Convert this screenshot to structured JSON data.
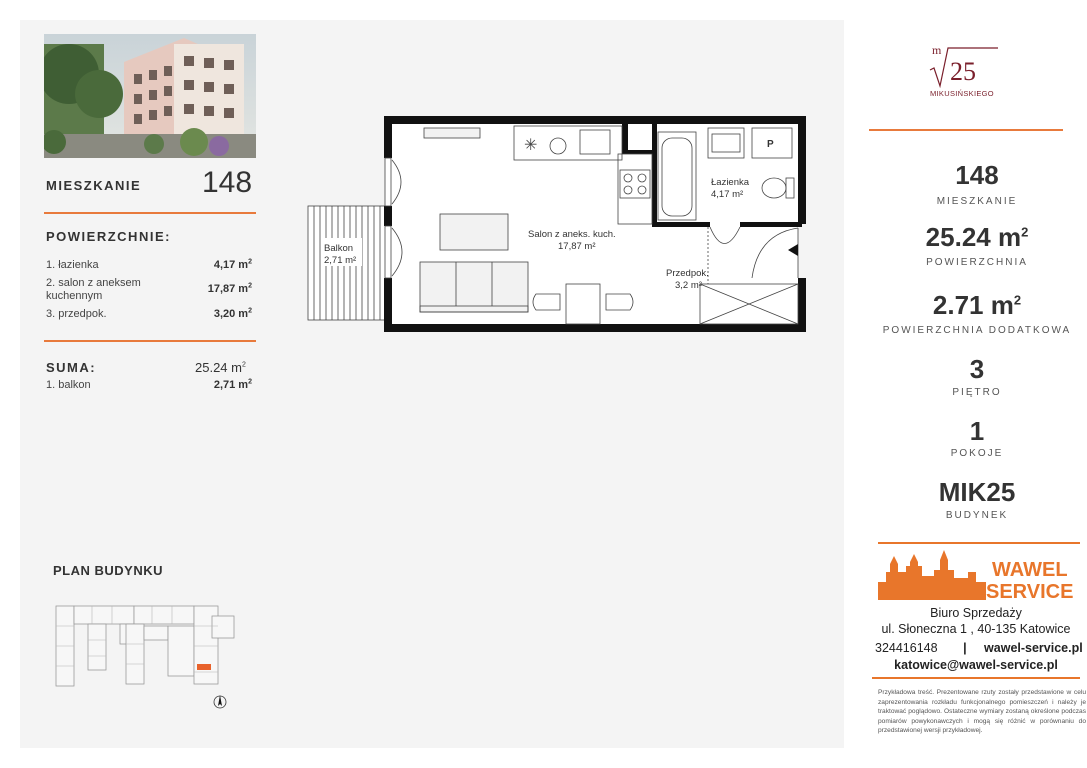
{
  "apartment": {
    "label": "MIESZKANIE",
    "number": "148"
  },
  "rooms_section": {
    "title": "POWIERZCHNIE:",
    "rooms": [
      {
        "name": "1. łazienka",
        "value": "4,17 m"
      },
      {
        "name": "2. salon z aneksem kuchennym",
        "value": "17,87 m"
      },
      {
        "name": "3. przedpok.",
        "value": "3,20 m"
      }
    ]
  },
  "summary": {
    "label": "SUMA:",
    "value": "25.24  m",
    "balcony_name": "1. balkon",
    "balcony_value": "2,71 m"
  },
  "floorplan": {
    "balcony": {
      "name": "Balkon",
      "area": "2,71 m²"
    },
    "living": {
      "name": "Salon z aneks. kuch.",
      "area": "17,87 m²"
    },
    "bathroom": {
      "name": "Łazienka",
      "area": "4,17 m²"
    },
    "hall": {
      "name": "Przedpok.",
      "area": "3,2 m²"
    },
    "wardrobe_letter": "P"
  },
  "building_plan": {
    "title": "PLAN BUDYNKU"
  },
  "logo": {
    "superscript": "m",
    "number": "25",
    "caption": "MIKUSIŃSKIEGO"
  },
  "stats": [
    {
      "value": "148",
      "unit": "",
      "label": "MIESZKANIE"
    },
    {
      "value": "25.24 m",
      "unit": "2",
      "label": "POWIERZCHNIA"
    },
    {
      "value": "2.71 m",
      "unit": "2",
      "label": "POWIERZCHNIA DODATKOWA"
    },
    {
      "value": "3",
      "unit": "",
      "label": "PIĘTRO"
    },
    {
      "value": "1",
      "unit": "",
      "label": "POKOJE"
    },
    {
      "value": "MIK25",
      "unit": "",
      "label": "BUDYNEK"
    }
  ],
  "agency": {
    "name_line1": "WAWEL",
    "name_line2": "SERVICE",
    "office_title": "Biuro Sprzedaży",
    "address": "ul. Słoneczna 1 , 40-135 Katowice",
    "phone": "324416148",
    "separator": "|",
    "website": "wawel-service.pl",
    "email": "katowice@wawel-service.pl",
    "brand_color": "#e8762b"
  },
  "disclaimer": "Przykładowa treść. Prezentowane rzuty zostały przedstawione w celu zaprezentowania rozkładu funkcjonalnego pomieszczeń i należy je traktować poglądowo. Ostateczne wymiary zostaną określone podczas pomiarów powykonawczych i mogą się różnić w porównaniu do przedstawionej wersji przykładowej.",
  "colors": {
    "accent": "#e87a3c",
    "logo": "#7a1f2b"
  }
}
